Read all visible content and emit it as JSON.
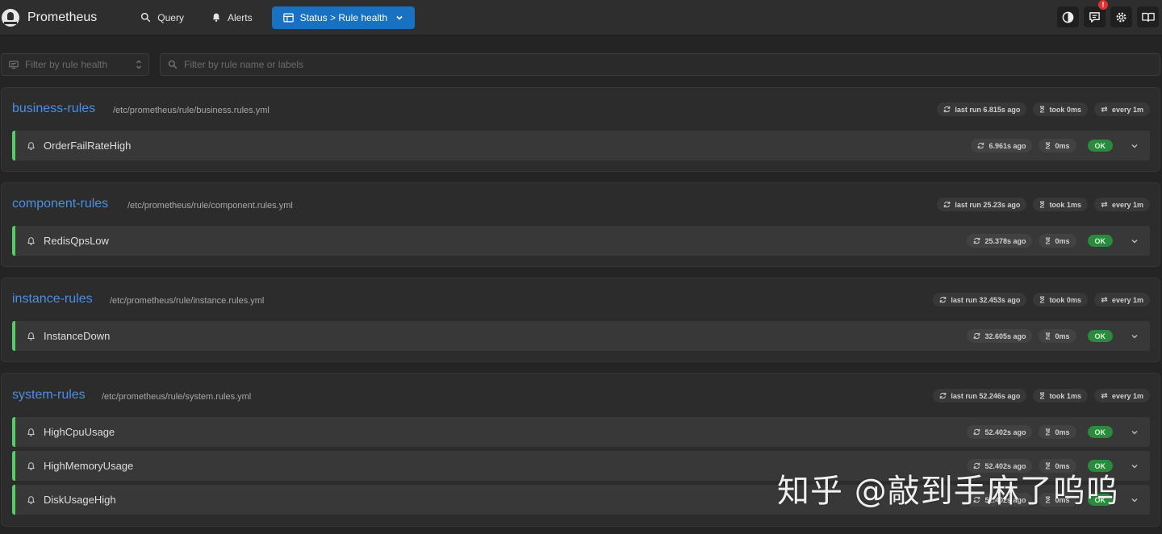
{
  "app": {
    "title": "Prometheus"
  },
  "nav": {
    "query": "Query",
    "alerts": "Alerts",
    "status": "Status > Rule health"
  },
  "header_icons": {
    "notification_count": "!"
  },
  "filters": {
    "health_placeholder": "Filter by rule health",
    "search_placeholder": "Filter by rule name or labels"
  },
  "groups": [
    {
      "name": "business-rules",
      "file": "/etc/prometheus/rule/business.rules.yml",
      "last_run": "last run 6.815s ago",
      "took": "took 0ms",
      "every": "every 1m",
      "rules": [
        {
          "name": "OrderFailRateHigh",
          "ago": "6.961s ago",
          "duration": "0ms",
          "health": "OK"
        }
      ]
    },
    {
      "name": "component-rules",
      "file": "/etc/prometheus/rule/component.rules.yml",
      "last_run": "last run 25.23s ago",
      "took": "took 1ms",
      "every": "every 1m",
      "rules": [
        {
          "name": "RedisQpsLow",
          "ago": "25.378s ago",
          "duration": "0ms",
          "health": "OK"
        }
      ]
    },
    {
      "name": "instance-rules",
      "file": "/etc/prometheus/rule/instance.rules.yml",
      "last_run": "last run 32.453s ago",
      "took": "took 0ms",
      "every": "every 1m",
      "rules": [
        {
          "name": "InstanceDown",
          "ago": "32.605s ago",
          "duration": "0ms",
          "health": "OK"
        }
      ]
    },
    {
      "name": "system-rules",
      "file": "/etc/prometheus/rule/system.rules.yml",
      "last_run": "last run 52.246s ago",
      "took": "took 1ms",
      "every": "every 1m",
      "rules": [
        {
          "name": "HighCpuUsage",
          "ago": "52.402s ago",
          "duration": "0ms",
          "health": "OK"
        },
        {
          "name": "HighMemoryUsage",
          "ago": "52.402s ago",
          "duration": "0ms",
          "health": "OK"
        },
        {
          "name": "DiskUsageHigh",
          "ago": "52.402s ago",
          "duration": "0ms",
          "health": "OK"
        }
      ]
    }
  ],
  "watermark": "知乎 @敲到手麻了呜呜",
  "colors": {
    "accent": "#1971c2",
    "ok": "#2b8a3e",
    "healthy_border": "#51cf66",
    "group_title": "#4a90e2"
  },
  "icons": [
    "prometheus-logo-icon",
    "search-icon",
    "bell-icon",
    "table-icon",
    "chevron-down-icon",
    "theme-toggle-icon",
    "notifications-icon",
    "settings-icon",
    "docs-icon",
    "refresh-icon",
    "hourglass-icon",
    "repeat-icon"
  ]
}
